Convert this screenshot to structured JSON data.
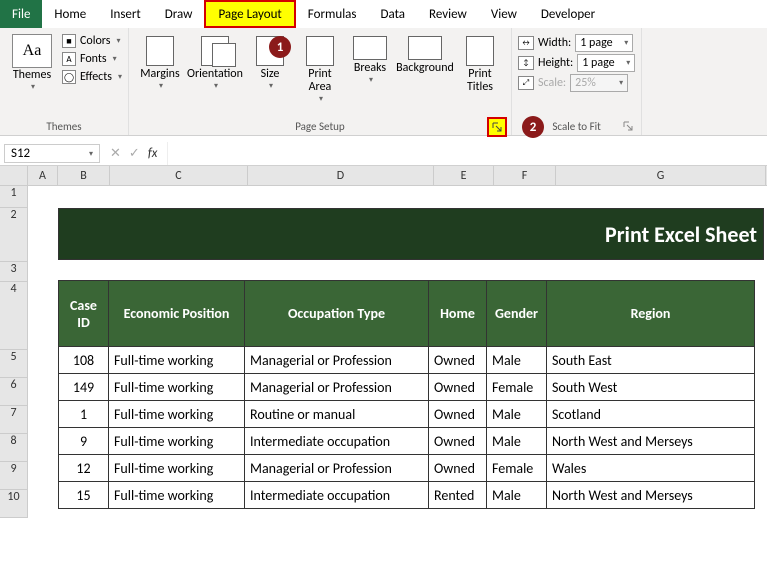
{
  "tabs": [
    "File",
    "Home",
    "Insert",
    "Draw",
    "Page Layout",
    "Formulas",
    "Data",
    "Review",
    "View",
    "Developer"
  ],
  "themes": {
    "btn": "Themes",
    "colors": "Colors",
    "fonts": "Fonts",
    "effects": "Effects",
    "group": "Themes"
  },
  "pagesetup": {
    "margins": "Margins",
    "orientation": "Orientation",
    "size": "Size",
    "printarea": "Print\nArea",
    "breaks": "Breaks",
    "background": "Background",
    "printtitles": "Print\nTitles",
    "group": "Page Setup"
  },
  "scale": {
    "width": "Width:",
    "height": "Height:",
    "scale": "Scale:",
    "val_w": "1 page",
    "val_h": "1 page",
    "val_s": "25%",
    "group": "Scale to Fit"
  },
  "namebox": "S12",
  "fx": "fx",
  "cols": [
    "A",
    "B",
    "C",
    "D",
    "E",
    "F",
    "G"
  ],
  "rows": [
    "1",
    "2",
    "3",
    "4",
    "5",
    "6",
    "7",
    "8",
    "9",
    "10"
  ],
  "title": "Print Excel Sheet",
  "headers": [
    "Case ID",
    "Economic Position",
    "Occupation Type",
    "Home",
    "Gender",
    "Region"
  ],
  "data": [
    [
      "108",
      "Full-time working",
      "Managerial or Profession",
      "Owned",
      "Male",
      "South East"
    ],
    [
      "149",
      "Full-time working",
      "Managerial or Profession",
      "Owned",
      "Female",
      "South West"
    ],
    [
      "1",
      "Full-time working",
      "Routine or manual",
      "Owned",
      "Male",
      "Scotland"
    ],
    [
      "9",
      "Full-time working",
      "Intermediate occupation",
      "Owned",
      "Male",
      "North West and Merseys"
    ],
    [
      "12",
      "Full-time working",
      "Managerial or Profession",
      "Owned",
      "Female",
      "Wales"
    ],
    [
      "15",
      "Full-time working",
      "Intermediate occupation",
      "Rented",
      "Male",
      "North West and Merseys"
    ]
  ]
}
